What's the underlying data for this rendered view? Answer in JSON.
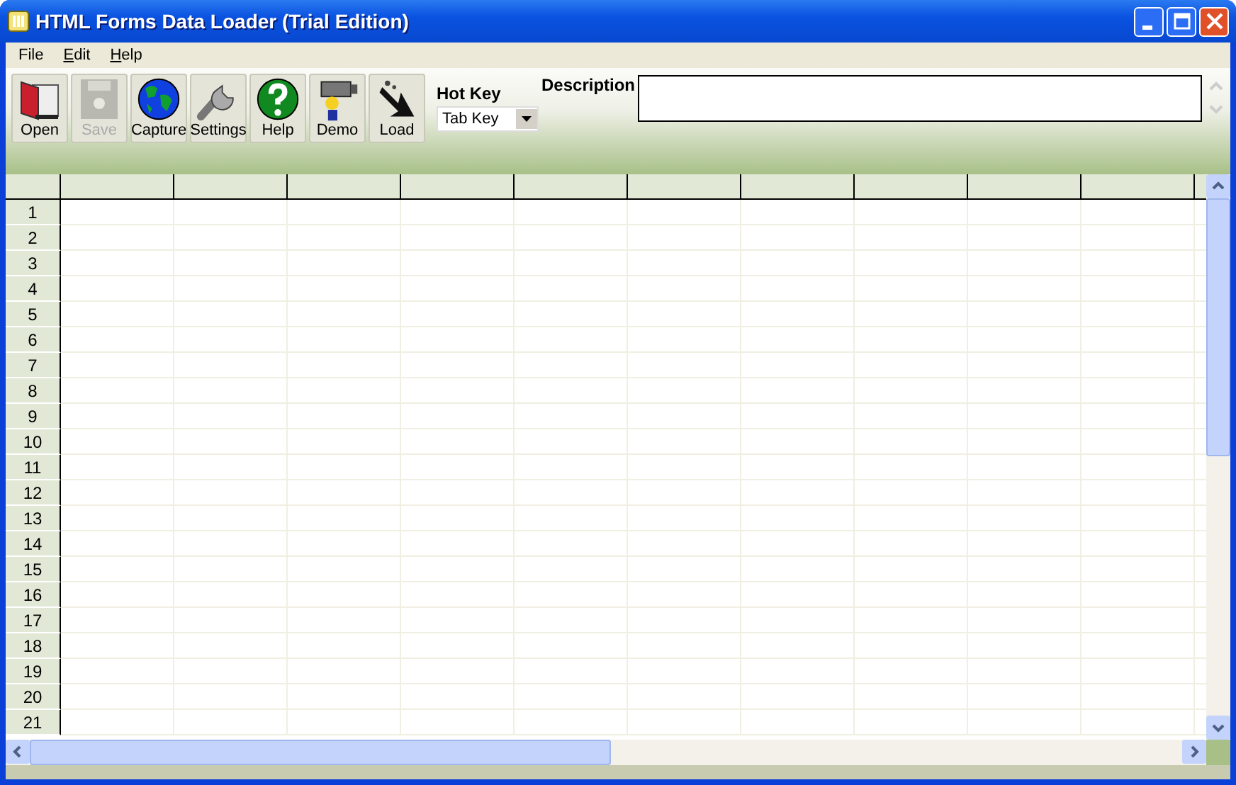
{
  "window": {
    "title": "HTML Forms Data Loader (Trial Edition)"
  },
  "menu": [
    {
      "label": "File",
      "mnemonic_underlined": false
    },
    {
      "label": "Edit",
      "mnemonic_underlined": true
    },
    {
      "label": "Help",
      "mnemonic_underlined": true
    }
  ],
  "toolbar": [
    {
      "label": "Open",
      "kind": "open",
      "disabled": false
    },
    {
      "label": "Save",
      "kind": "save",
      "disabled": true
    },
    {
      "label": "Capture",
      "kind": "capture",
      "disabled": false
    },
    {
      "label": "Settings",
      "kind": "settings",
      "disabled": false
    },
    {
      "label": "Help",
      "kind": "help",
      "disabled": false
    },
    {
      "label": "Demo",
      "kind": "demo",
      "disabled": false
    },
    {
      "label": "Load",
      "kind": "load",
      "disabled": false
    }
  ],
  "hot_key": {
    "label": "Hot Key",
    "value": "Tab Key"
  },
  "description": {
    "label": "Description"
  },
  "grid": {
    "rows": [
      "1",
      "2",
      "3",
      "4",
      "5",
      "6",
      "7",
      "8",
      "9",
      "10",
      "11",
      "12",
      "13",
      "14",
      "15",
      "16",
      "17",
      "18",
      "19",
      "20",
      "21"
    ]
  }
}
